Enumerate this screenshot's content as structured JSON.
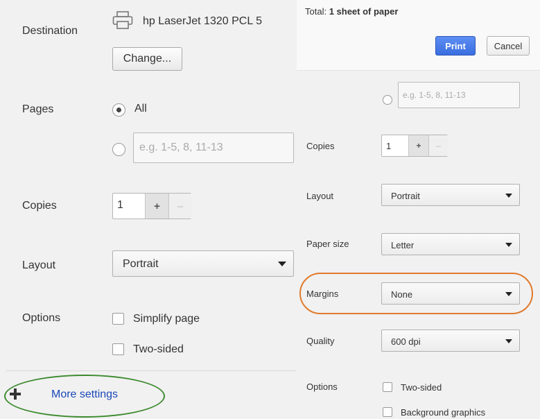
{
  "left": {
    "destination_label": "Destination",
    "printer_name": "hp LaserJet 1320 PCL 5",
    "change_button": "Change...",
    "pages_label": "Pages",
    "pages_all": "All",
    "pages_placeholder": "e.g. 1-5, 8, 11-13",
    "copies_label": "Copies",
    "copies_value": "1",
    "plus": "+",
    "minus": "–",
    "layout_label": "Layout",
    "layout_value": "Portrait",
    "options_label": "Options",
    "opt_simplify": "Simplify page",
    "opt_two_sided": "Two-sided",
    "more_settings": "More settings"
  },
  "right": {
    "total_prefix": "Total: ",
    "total_value": "1 sheet of paper",
    "print_button": "Print",
    "cancel_button": "Cancel",
    "pages_placeholder": "e.g. 1-5, 8, 11-13",
    "copies_label": "Copies",
    "copies_value": "1",
    "plus": "+",
    "minus": "–",
    "layout_label": "Layout",
    "layout_value": "Portrait",
    "paper_size_label": "Paper size",
    "paper_size_value": "Letter",
    "margins_label": "Margins",
    "margins_value": "None",
    "quality_label": "Quality",
    "quality_value": "600 dpi",
    "options_label": "Options",
    "opt_two_sided": "Two-sided",
    "opt_background": "Background graphics"
  },
  "colors": {
    "link": "#1a48b8",
    "print_button": "#3a6ee0",
    "highlight_green": "#3c8a2e",
    "highlight_orange": "#e07a2c"
  },
  "icons": {
    "printer": "printer-icon",
    "plus": "plus-icon",
    "dropdown": "chevron-down-icon"
  }
}
